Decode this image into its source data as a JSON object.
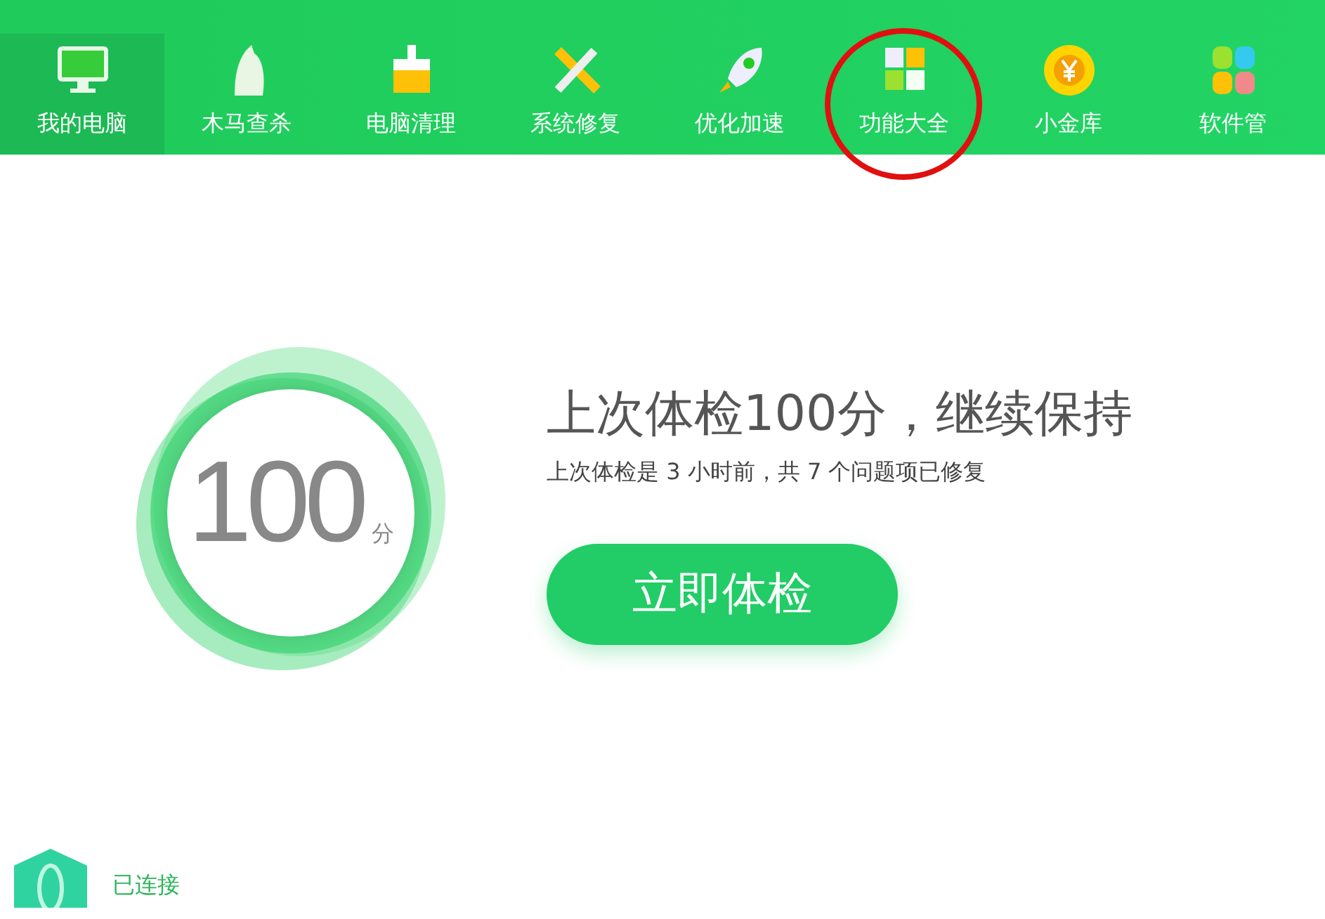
{
  "nav": [
    {
      "label": "我的电脑",
      "kind": "monitor",
      "selected": true,
      "circled": false
    },
    {
      "label": "木马查杀",
      "kind": "horse",
      "selected": false,
      "circled": false
    },
    {
      "label": "电脑清理",
      "kind": "brush",
      "selected": false,
      "circled": false
    },
    {
      "label": "系统修复",
      "kind": "tools",
      "selected": false,
      "circled": false
    },
    {
      "label": "优化加速",
      "kind": "rocket",
      "selected": false,
      "circled": false
    },
    {
      "label": "功能大全",
      "kind": "grid",
      "selected": false,
      "circled": true
    },
    {
      "label": "小金库",
      "kind": "coin",
      "selected": false,
      "circled": false
    },
    {
      "label": "软件管",
      "kind": "petals",
      "selected": false,
      "circled": false
    }
  ],
  "score": {
    "value": "100",
    "unit": "分"
  },
  "headline": "上次体检100分，继续保持",
  "subtitle": "上次体检是 3 小时前，共 7 个问题项已修复",
  "check_button": "立即体检",
  "status": {
    "text": "已连接"
  }
}
